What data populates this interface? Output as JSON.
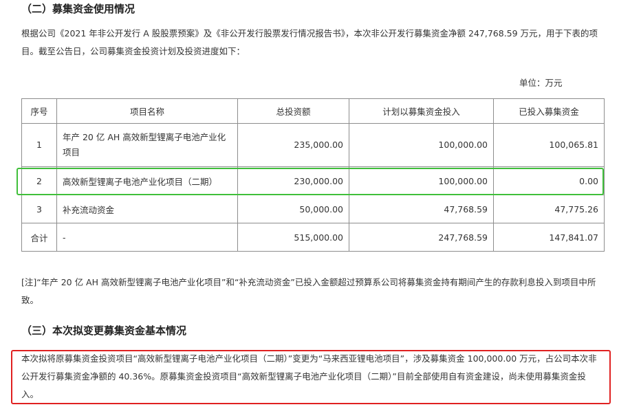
{
  "section2": {
    "title": "（二）募集资金使用情况",
    "intro": "根据公司《2021 年非公开发行 A 股股票预案》及《非公开发行股票发行情况报告书》，本次非公开发行募集资金净额 247,768.59 万元，用于下表的项目。截至公告日，公司募集资金投资计划及投资进度如下：",
    "unit": "单位：万元"
  },
  "table": {
    "headers": [
      "序号",
      "项目名称",
      "总投资额",
      "计划以募集资金投入",
      "已投入募集资金"
    ],
    "rows": [
      [
        "1",
        "年产 20 亿 AH 高效新型锂离子电池产业化项目",
        "235,000.00",
        "100,000.00",
        "100,065.81"
      ],
      [
        "2",
        "高效新型锂离子电池产业化项目（二期）",
        "230,000.00",
        "100,000.00",
        "0.00"
      ],
      [
        "3",
        "补充流动资金",
        "50,000.00",
        "47,768.59",
        "47,775.26"
      ],
      [
        "合计",
        "-",
        "515,000.00",
        "247,768.59",
        "147,841.07"
      ]
    ]
  },
  "note": "[注]“年产 20 亿 AH 高效新型锂离子电池产业化项目”和“补充流动资金”已投入金额超过预算系公司将募集资金持有期间产生的存款利息投入到项目中所致。",
  "section3": {
    "title": "（三）本次拟变更募集资金基本情况",
    "body": "本次拟将原募集资金投资项目“高效新型锂离子电池产业化项目（二期）”变更为“马来西亚锂电池项目”，涉及募集资金 100,000.00 万元，占公司本次非公开发行募集资金净额的 40.36%。原募集资金投资项目“高效新型锂离子电池产业化项目（二期）”目前全部使用自有资金建设，尚未使用募集资金投入。"
  },
  "colors": {
    "highlight_green": "#3fbf3a",
    "highlight_red": "#e02020",
    "table_border": "#8c8c8c"
  }
}
